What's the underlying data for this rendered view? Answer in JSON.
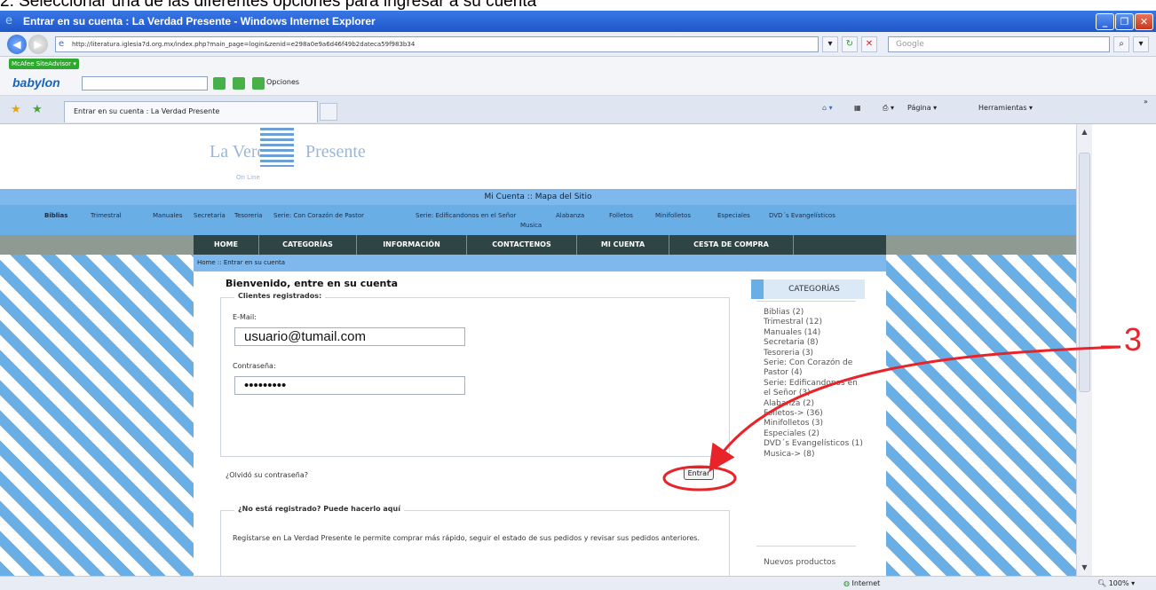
{
  "caption": "2. Seleccionar una de las diferentes opciones para ingresar a su cuenta",
  "window": {
    "title": "Entrar en su cuenta : La Verdad Presente - Windows Internet Explorer",
    "minimize_glyph": "_",
    "maximize_glyph": "❐",
    "close_glyph": "✕"
  },
  "address_bar": {
    "url": "http://literatura.iglesia7d.org.mx/index.php?main_page=login&zenid=e298a0e9a6d46f49b2dateca59f983b34",
    "search_placeholder": "Google"
  },
  "toolbars": {
    "mcafee_label": "McAfee SiteAdvisor ▾",
    "babylon_label": "babylon",
    "opciones_label": "Opciones"
  },
  "tab": {
    "title": "Entrar en su cuenta : La Verdad Presente"
  },
  "command_bar": {
    "pagina": "Página ▾",
    "herramientas": "Herramientas ▾",
    "more": "»"
  },
  "site": {
    "logo_left": "La Verdad",
    "logo_right": "Presente",
    "logo_sub": "On Line",
    "top_links": "Mi Cuenta :: Mapa del Sitio",
    "categories_bar": [
      "Biblias",
      "Trimestral",
      "Manuales",
      "Secretaria",
      "Tesoreria",
      "Serie: Con Corazón de Pastor",
      "Serie: Edificandonos en el Señor",
      "Alabanza",
      "Folletos",
      "Minifolletos",
      "Especiales",
      "DVD´s Evangelísticos"
    ],
    "categories_bar_musica": "Musica",
    "menu": [
      "HOME",
      "CATEGORÍAS",
      "INFORMACIÓN",
      "CONTACTENOS",
      "MI CUENTA",
      "CESTA DE COMPRA"
    ],
    "breadcrumb": "Home :: Entrar en su cuenta"
  },
  "login": {
    "heading": "Bienvenido, entre en su cuenta",
    "registered_legend": "Clientes registrados:",
    "email_label": "E-Mail:",
    "email_value": "usuario@tumail.com",
    "password_label": "Contraseña:",
    "password_value": "•••••••••",
    "forgot_link": "¿Olvidó su contraseña?",
    "submit_label": "Entrar",
    "register_legend": "¿No está registrado? Puede hacerlo aquí",
    "register_text": "Regístarse en La Verdad Presente le permite comprar más rápido, seguir el estado de sus pedidos y revisar sus pedidos anteriores."
  },
  "sidebar": {
    "title": "CATEGORÍAS",
    "items": [
      "Biblias (2)",
      "Trimestral (12)",
      "Manuales (14)",
      "Secretaria (8)",
      "Tesoreria (3)",
      "Serie: Con Corazón de",
      "Pastor (4)",
      "Serie: Edificandonos en",
      "el Señor (3)",
      "Alabanza (2)",
      "Folletos-> (36)",
      "Minifolletos (3)",
      "Especiales (2)",
      "DVD´s Evangelísticos (1)",
      "Musica-> (8)"
    ],
    "new_products": "Nuevos productos"
  },
  "status_bar": {
    "zone": "Internet",
    "zoom": "100%"
  },
  "annotation": {
    "step_number": "3",
    "color": "#e8232a"
  }
}
